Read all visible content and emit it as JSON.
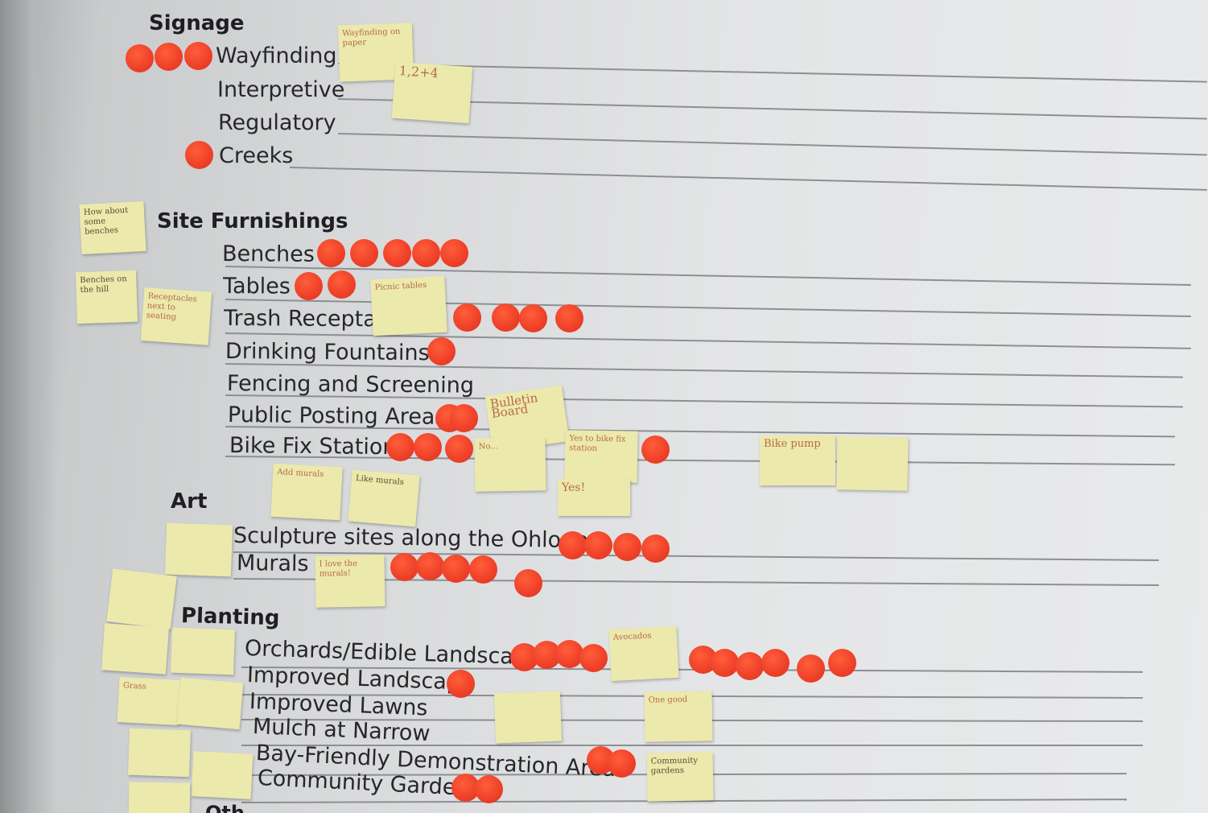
{
  "sections": [
    {
      "heading": "Signage",
      "items": [
        "Wayfinding",
        "Interpretive",
        "Regulatory",
        "Creeks"
      ]
    },
    {
      "heading": "Site Furnishings",
      "items": [
        "Benches",
        "Tables",
        "Trash Receptac",
        "Drinking Fountains",
        "Fencing and Screening",
        "Public Posting Areas",
        "Bike Fix Station"
      ]
    },
    {
      "heading": "Art",
      "items": [
        "Sculpture sites along the Ohlone",
        "Murals"
      ]
    },
    {
      "heading": "Planting",
      "items": [
        "Orchards/Edible Landscape",
        "Improved Landscape",
        "Improved Lawns",
        "Mulch at Narrow",
        "Bay-Friendly Demonstration Areas",
        "Community Gardens"
      ]
    }
  ],
  "bottom_fragment": "Oth",
  "sticky_notes": [
    "Wayfinding on paper",
    "1,2+4",
    "How about some benches",
    "Benches on the hill",
    "Receptacles next to seating",
    "Picnic tables",
    "Bulletin Board",
    "No...",
    "Yes to bike fix station",
    "Bike pump",
    "Add murals",
    "Like murals",
    "Yes!",
    "I love the murals!",
    "Avocados",
    "One good",
    "Grass",
    "Community gardens"
  ],
  "colors": {
    "dot": "#f0422a",
    "note": "#ece9ad",
    "wall": "#e2e3e4"
  }
}
